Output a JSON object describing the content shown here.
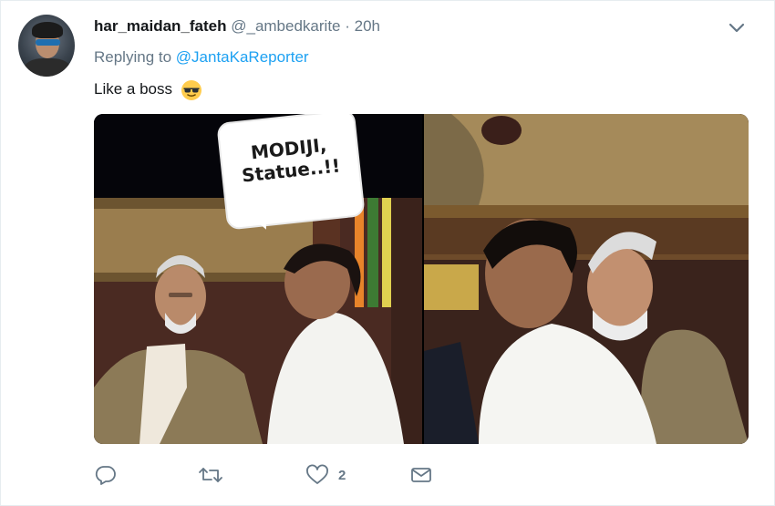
{
  "tweet": {
    "display_name": "har_maidan_fateh",
    "handle": "@_ambedkarite",
    "separator": "·",
    "timestamp": "20h",
    "replying_prefix": "Replying to",
    "replying_to": "@JantaKaReporter",
    "text": "Like a boss",
    "emoji": "smiling-face-with-sunglasses"
  },
  "media": {
    "caption_bubble": "MODIJI,\nStatue..!!"
  },
  "actions": {
    "reply_count": "",
    "retweet_count": "",
    "like_count": "2",
    "dm_label": ""
  },
  "colors": {
    "link": "#1da1f2",
    "muted": "#657786",
    "text": "#14171a"
  }
}
